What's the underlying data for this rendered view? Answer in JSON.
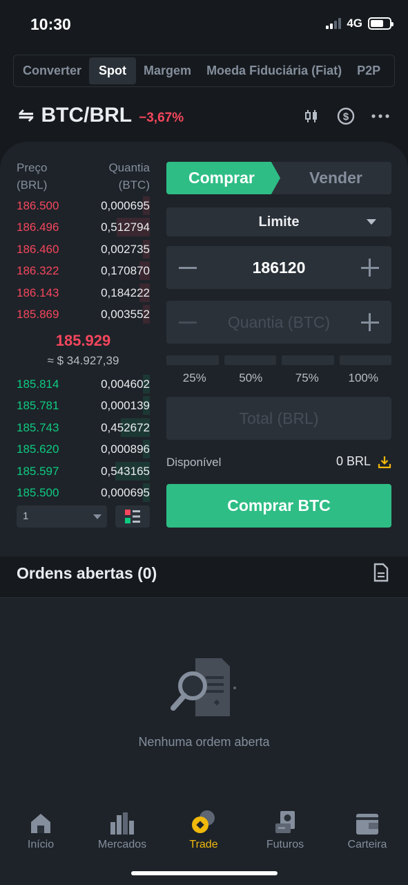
{
  "status_bar": {
    "time": "10:30",
    "network": "4G"
  },
  "top_tabs": [
    {
      "label": "Converter",
      "active": false
    },
    {
      "label": "Spot",
      "active": true
    },
    {
      "label": "Margem",
      "active": false
    },
    {
      "label": "Moeda Fiduciária (Fiat)",
      "active": false
    },
    {
      "label": "P2P",
      "active": false
    }
  ],
  "pair": {
    "name": "BTC/BRL",
    "change": "−3,67%"
  },
  "orderbook": {
    "price_header": "Preço",
    "price_unit": "(BRL)",
    "qty_header": "Quantia",
    "qty_unit": "(BTC)",
    "asks": [
      {
        "price": "186.500",
        "qty": "0,000695",
        "depth": 0.05
      },
      {
        "price": "186.496",
        "qty": "0,512794",
        "depth": 0.25
      },
      {
        "price": "186.460",
        "qty": "0,002735",
        "depth": 0.05
      },
      {
        "price": "186.322",
        "qty": "0,170870",
        "depth": 0.08
      },
      {
        "price": "186.143",
        "qty": "0,184222",
        "depth": 0.08
      },
      {
        "price": "185.869",
        "qty": "0,003552",
        "depth": 0.05
      }
    ],
    "mid_price": "185.929",
    "mid_fiat": "≈ $ 34.927,39",
    "bids": [
      {
        "price": "185.814",
        "qty": "0,004602",
        "depth": 0.05
      },
      {
        "price": "185.781",
        "qty": "0,000139",
        "depth": 0.05
      },
      {
        "price": "185.743",
        "qty": "0,452672",
        "depth": 0.22
      },
      {
        "price": "185.620",
        "qty": "0,000896",
        "depth": 0.05
      },
      {
        "price": "185.597",
        "qty": "0,543165",
        "depth": 0.26
      },
      {
        "price": "185.500",
        "qty": "0,000695",
        "depth": 0.05
      }
    ],
    "depth_select": "1"
  },
  "form": {
    "buy_tab": "Comprar",
    "sell_tab": "Vender",
    "order_type": "Limite",
    "price_value": "186120",
    "qty_placeholder": "Quantia (BTC)",
    "percentages": [
      "25%",
      "50%",
      "75%",
      "100%"
    ],
    "total_placeholder": "Total (BRL)",
    "available_label": "Disponível",
    "available_value": "0 BRL",
    "submit_label": "Comprar BTC"
  },
  "open_orders": {
    "title": "Ordens abertas (0)",
    "empty_text": "Nenhuma ordem aberta"
  },
  "bottom_nav": [
    {
      "label": "Início",
      "icon": "home-icon",
      "active": false
    },
    {
      "label": "Mercados",
      "icon": "markets-icon",
      "active": false
    },
    {
      "label": "Trade",
      "icon": "trade-icon",
      "active": true
    },
    {
      "label": "Futuros",
      "icon": "futures-icon",
      "active": false
    },
    {
      "label": "Carteira",
      "icon": "wallet-icon",
      "active": false
    }
  ],
  "colors": {
    "background": "#161A1E",
    "panel": "#1E2329",
    "buy": "#2EBD85",
    "sell": "#F6465D",
    "accent": "#F0B90B"
  }
}
